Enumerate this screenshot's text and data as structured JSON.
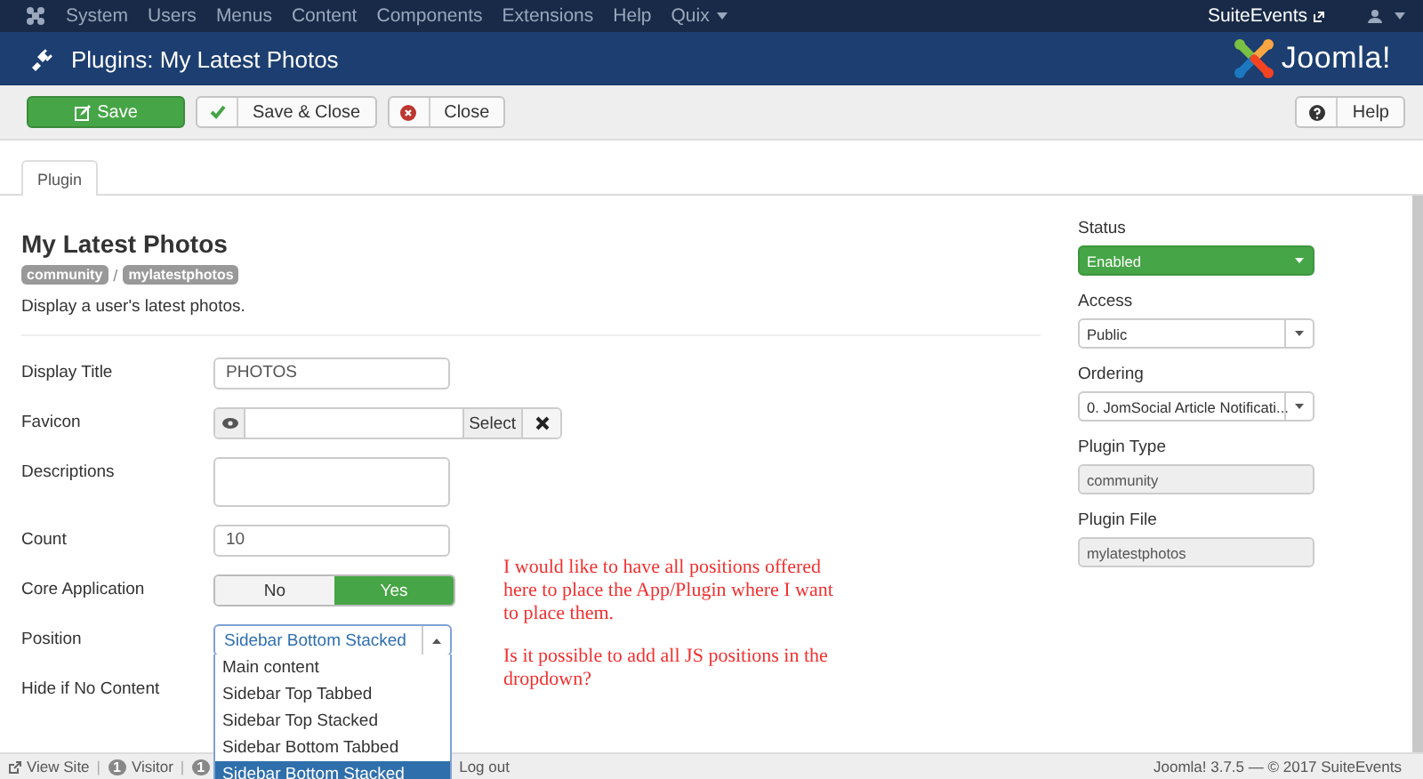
{
  "top_menu": {
    "items": [
      {
        "label": "System",
        "has_caret": false
      },
      {
        "label": "Users",
        "has_caret": false
      },
      {
        "label": "Menus",
        "has_caret": false
      },
      {
        "label": "Content",
        "has_caret": false
      },
      {
        "label": "Components",
        "has_caret": false
      },
      {
        "label": "Extensions",
        "has_caret": false
      },
      {
        "label": "Help",
        "has_caret": false
      },
      {
        "label": "Quix",
        "has_caret": true
      }
    ],
    "site_link": "SuiteEvents"
  },
  "header": {
    "title": "Plugins: My Latest Photos",
    "logo_text": "Joomla!"
  },
  "toolbar": {
    "buttons": [
      {
        "label": "Save",
        "kind": "save"
      },
      {
        "label": "Save & Close",
        "kind": "check"
      },
      {
        "label": "Close",
        "kind": "cancel"
      },
      {
        "label": "Help",
        "kind": "help"
      }
    ]
  },
  "tabs": [
    {
      "label": "Plugin",
      "selected": true
    }
  ],
  "plugin": {
    "title": "My Latest Photos",
    "badges": [
      "community",
      "mylatestphotos"
    ],
    "separator": "/",
    "description": "Display a user's latest photos."
  },
  "fields": [
    {
      "label": "Display Title",
      "kind": "text",
      "value": "PHOTOS"
    },
    {
      "label": "Favicon",
      "kind": "media",
      "button": "Select"
    },
    {
      "label": "Descriptions",
      "kind": "textarea"
    },
    {
      "label": "Count",
      "kind": "text",
      "value": "10"
    },
    {
      "label": "Core Application",
      "kind": "toggle",
      "options": [
        {
          "label": "No",
          "selected": false
        },
        {
          "label": "Yes",
          "selected": true
        }
      ]
    },
    {
      "label": "Position",
      "kind": "select",
      "value": "Sidebar Bottom Stacked",
      "expanded": true,
      "options": [
        {
          "label": "Main content",
          "selected": false
        },
        {
          "label": "Sidebar Top Tabbed",
          "selected": false
        },
        {
          "label": "Sidebar Top Stacked",
          "selected": false
        },
        {
          "label": "Sidebar Bottom Tabbed",
          "selected": false
        },
        {
          "label": "Sidebar Bottom Stacked",
          "selected": true
        }
      ]
    },
    {
      "label": "Hide if No Content"
    }
  ],
  "sidebar": [
    {
      "label": "Status",
      "kind": "status",
      "value": "Enabled"
    },
    {
      "label": "Access",
      "kind": "select",
      "value": "Public"
    },
    {
      "label": "Ordering",
      "kind": "select",
      "value": "0. JomSocial Article Notificati..."
    },
    {
      "label": "Plugin Type",
      "kind": "readonly",
      "value": "community"
    },
    {
      "label": "Plugin File",
      "kind": "readonly",
      "value": "mylatestphotos"
    }
  ],
  "annotation": {
    "paragraphs": [
      "I would like to have all positions offered here to place the App/Plugin where I want to place them.",
      "Is it possible to add all JS positions in the dropdown?"
    ]
  },
  "footer": {
    "view_site": "View Site",
    "separators": [
      "|",
      "|"
    ],
    "visitors": {
      "count": "1",
      "label": "Visitor"
    },
    "admins": {
      "count": "1"
    },
    "logout": "Log out",
    "copyright": "Joomla! 3.7.5 — © 2017 SuiteEvents"
  }
}
